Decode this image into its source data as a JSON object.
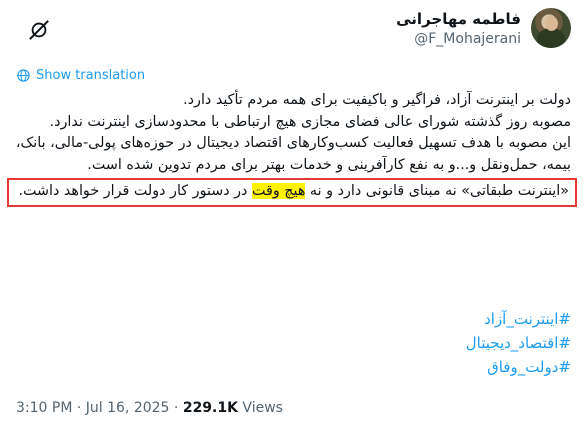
{
  "author": {
    "display_name": "فاطمه مهاجرانی",
    "handle": "@F_Mohajerani"
  },
  "translate": {
    "label": "Show translation",
    "icon": "translate-icon"
  },
  "tweet": {
    "paragraphs": [
      "دولت بر اینترنت آزاد، فراگیر و باکیفیت برای همه مردم تأکید دارد.",
      "مصوبه روز گذشته شورای عالی فضای مجازی هیچ ارتباطی با محدودسازی اینترنت ندارد.",
      "این مصوبه با هدف تسهیل فعالیت کسب‌وکارهای اقتصاد دیجیتال در حوزه‌های پولی-مالی، بانک، بیمه، حمل‌ونقل و...و به نفع کارآفرینی و خدمات بهتر برای مردم تدوین شده است."
    ],
    "quote_before": "«اینترنت طبقاتی» نه مبنای قانونی دارد و نه ",
    "quote_highlight": "هیچ وقت",
    "quote_after": " در دستور کار دولت قرار خواهد داشت."
  },
  "hashtags": [
    "#اینترنت_آزاد",
    "#اقتصاد_دیجیتال",
    "#دولت_وفاق"
  ],
  "meta": {
    "time": "3:10 PM",
    "date": "Jul 16, 2025",
    "views_count": "229.1K",
    "views_label": "Views"
  },
  "colors": {
    "link": "#1d9bf0",
    "highlight": "#fff200",
    "box_border": "#e53935",
    "secondary_text": "#536471"
  }
}
